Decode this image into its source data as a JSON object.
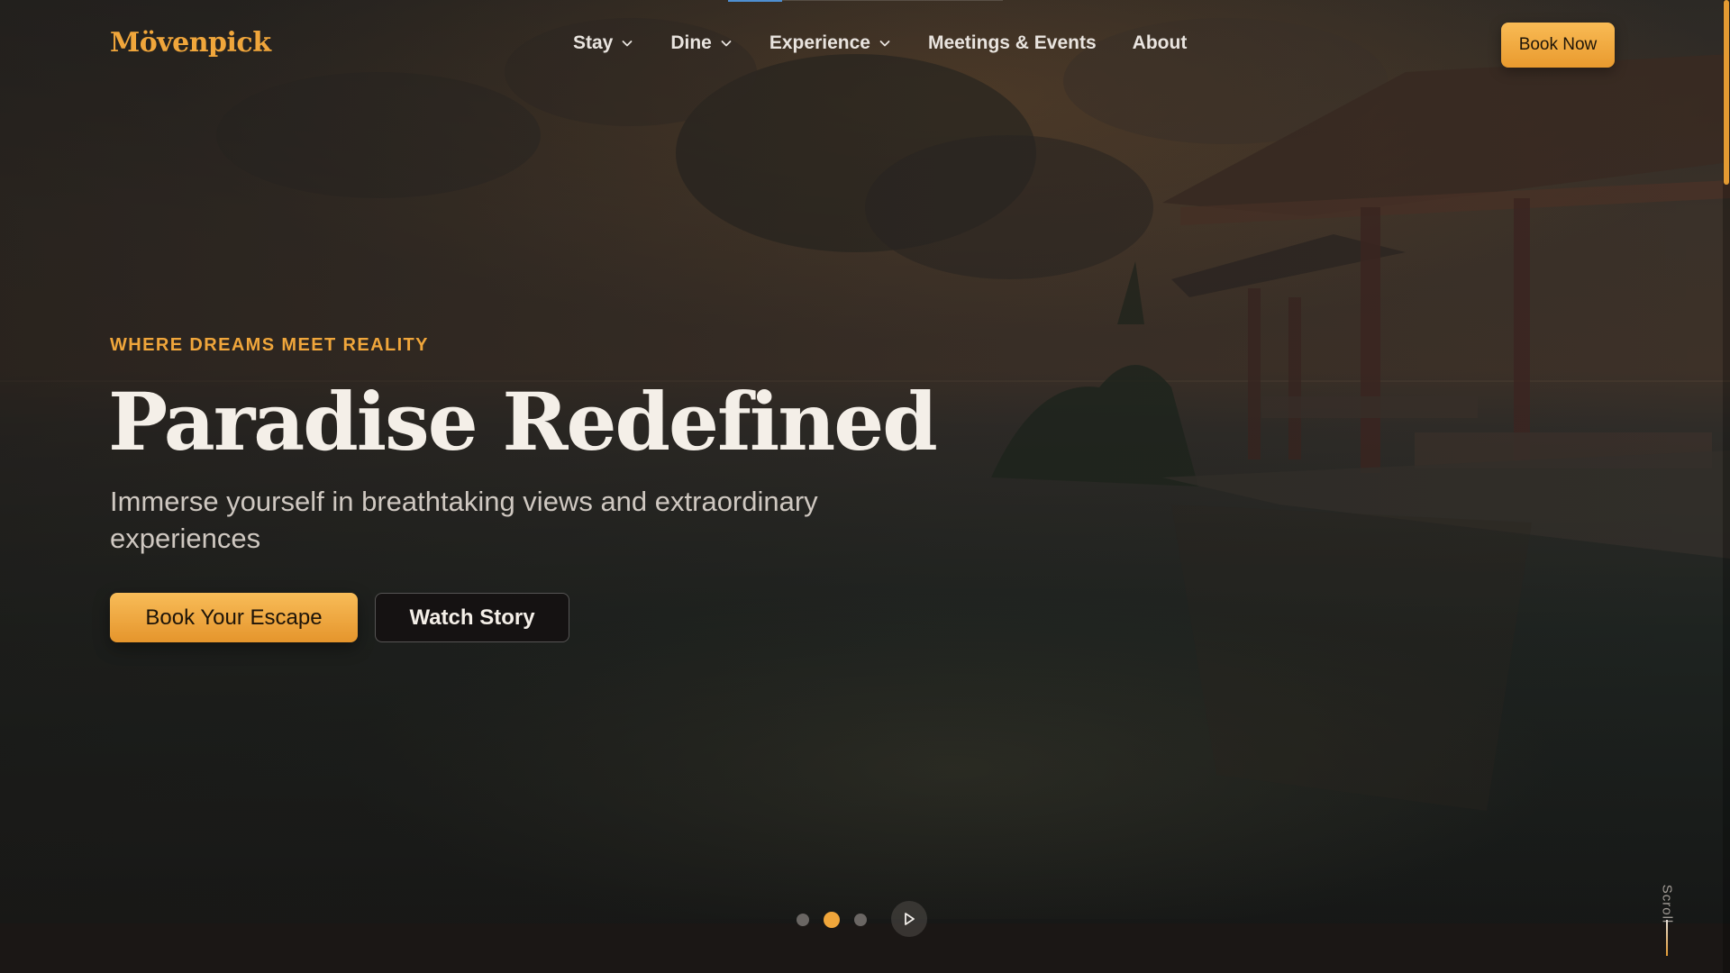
{
  "brand": {
    "logo_text": "Mövenpick",
    "accent_color": "#f0a63b"
  },
  "nav": {
    "items": [
      {
        "label": "Stay",
        "has_dropdown": true,
        "icon": "chevron-down-icon"
      },
      {
        "label": "Dine",
        "has_dropdown": true,
        "icon": "chevron-down-icon"
      },
      {
        "label": "Experience",
        "has_dropdown": true,
        "icon": "chevron-down-icon"
      },
      {
        "label": "Meetings & Events",
        "has_dropdown": false
      },
      {
        "label": "About",
        "has_dropdown": false
      }
    ],
    "cta_label": "Book Now"
  },
  "hero": {
    "eyebrow": "WHERE DREAMS MEET REALITY",
    "title": "Paradise Redefined",
    "subtitle": "Immerse yourself in breathtaking views and extraordinary experiences",
    "primary_button": "Book Your Escape",
    "secondary_button": "Watch Story"
  },
  "slider": {
    "slide_count": 3,
    "active_index": 1,
    "play_icon": "play-icon"
  },
  "scroll_cue": {
    "label": "Scroll"
  }
}
